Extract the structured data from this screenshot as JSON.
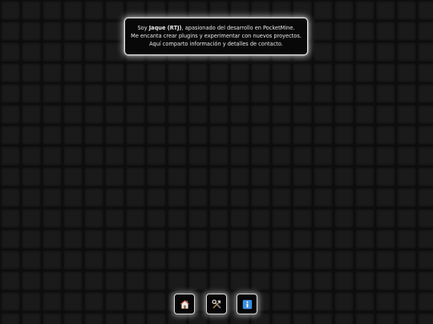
{
  "about": {
    "intro_prefix": "Soy ",
    "name": "Jaque (RTJ)",
    "intro_suffix": ", apasionado del desarrollo en PocketMine.",
    "line2": "Me encanta crear plugins y experimentar con nuevos proyectos.",
    "line3": "Aquí comparto información y detalles de contacto."
  },
  "nav": {
    "items": [
      {
        "icon": "home-icon",
        "color": "#f4a23a"
      },
      {
        "icon": "tools-icon",
        "color": "#c9c9c9"
      },
      {
        "icon": "info-icon",
        "color": "#3d8fe0"
      }
    ]
  },
  "colors": {
    "background": "#0d0d0d",
    "tile": "#1a1a1a",
    "card_border": "#e8e8e8",
    "text": "#ececec"
  }
}
